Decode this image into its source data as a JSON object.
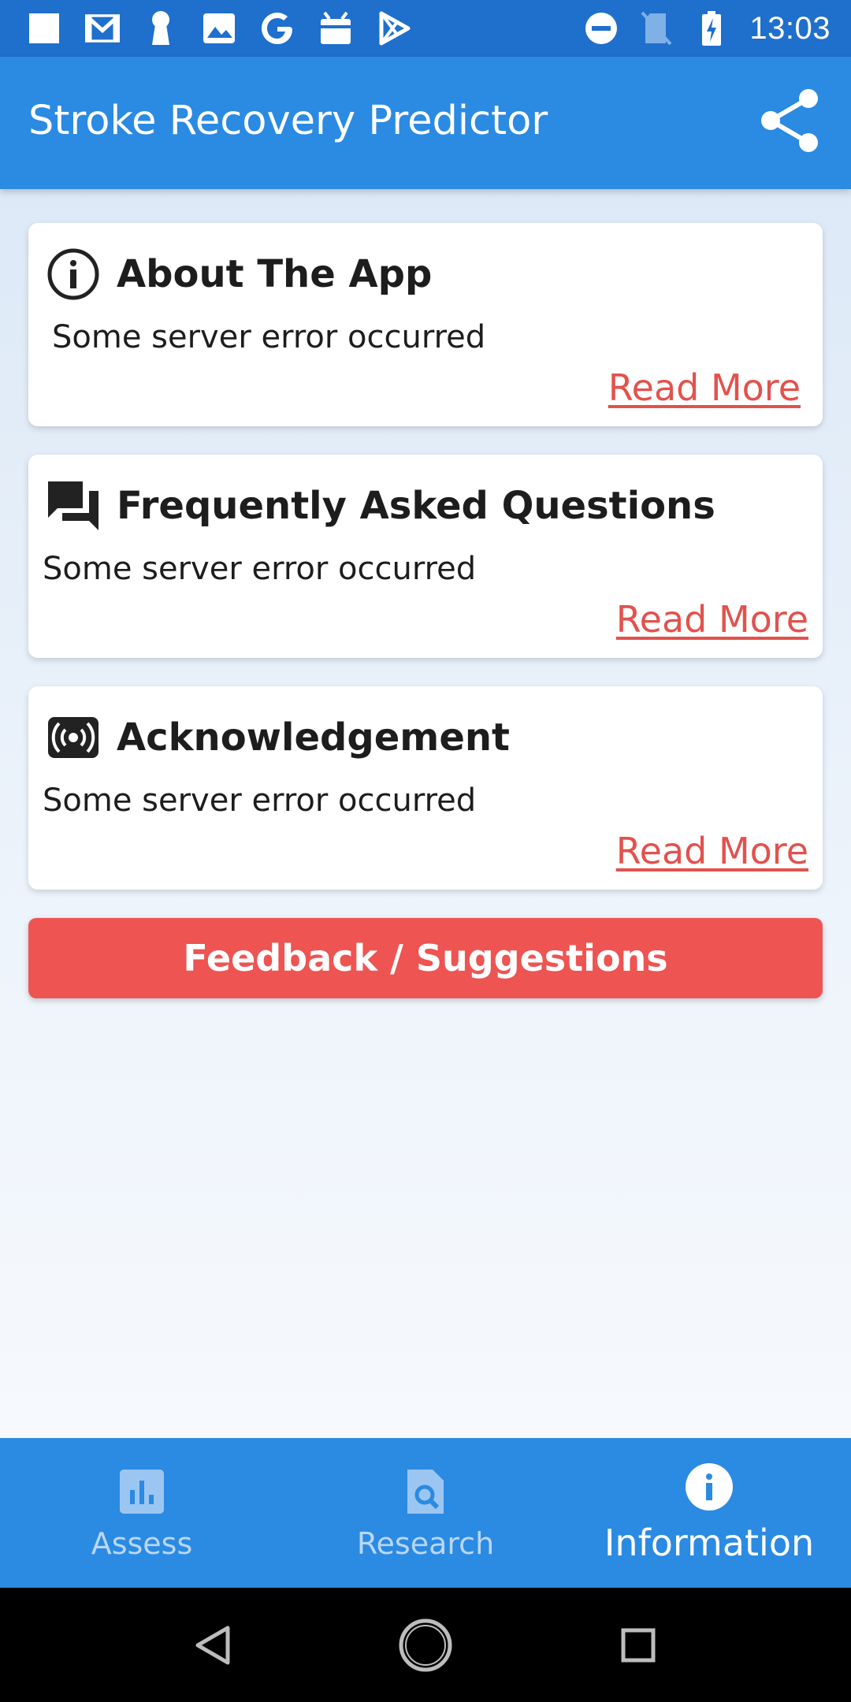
{
  "status_bar": {
    "time": "13:03",
    "left_icons": [
      "square-icon",
      "gmail-icon",
      "keyhole-icon",
      "image-icon",
      "google-icon",
      "android-icon",
      "play-store-icon"
    ],
    "right_icons": [
      "do-not-disturb-icon",
      "no-sim-icon",
      "battery-charging-icon"
    ]
  },
  "app_bar": {
    "title": "Stroke Recovery Predictor",
    "share_icon": "share-icon"
  },
  "cards": [
    {
      "icon": "info-icon",
      "title": "About The App",
      "text": "Some server error occurred",
      "link": "Read More"
    },
    {
      "icon": "forum-icon",
      "title": "Frequently Asked Questions",
      "text": "Some server error occurred",
      "link": "Read More"
    },
    {
      "icon": "radio-waves-icon",
      "title": "Acknowledgement",
      "text": "Some server error occurred",
      "link": "Read More"
    }
  ],
  "feedback_button": {
    "label": "Feedback / Suggestions"
  },
  "bottom_nav": {
    "items": [
      {
        "label": "Assess",
        "icon": "chart-icon",
        "active": false
      },
      {
        "label": "Research",
        "icon": "doc-search-icon",
        "active": false
      },
      {
        "label": "Information",
        "icon": "info-circle-icon",
        "active": true
      }
    ]
  },
  "colors": {
    "app_bar": "#2b8ae2",
    "status_bar": "#1f6fcc",
    "accent_red": "#ee5452",
    "link_red": "#e2524d"
  }
}
